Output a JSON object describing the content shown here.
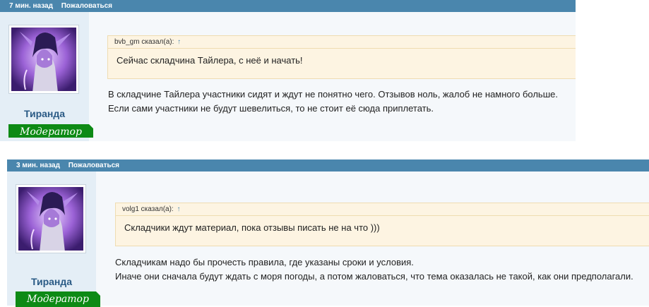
{
  "posts": [
    {
      "time": "7 мин. назад",
      "complain": "Пожаловаться",
      "username": "Тиранда",
      "badge": "Модератор",
      "quote_author": "bvb_gm сказал(а):",
      "quote_arrow": "↑",
      "quote_text": "Сейчас складчина Тайлера, с неё и начать!",
      "message_lines": [
        "В складчине Тайлера участники сидят и ждут не понятно чего. Отзывов ноль, жалоб не намного больше.",
        "Если сами участники не будут шевелиться, то не стоит её сюда приплетать."
      ]
    },
    {
      "time": "3 мин. назад",
      "complain": "Пожаловаться",
      "username": "Тиранда",
      "badge": "Модератор",
      "quote_author": "volg1 сказал(а):",
      "quote_arrow": "↑",
      "quote_text": "Складчики ждут материал, пока отзывы писать не на что )))",
      "message_lines": [
        "Складчикам надо бы прочесть правила, где указаны сроки и условия.",
        "Иначе они сначала будут ждать с моря погоды, а потом жаловаться, что тема оказалась не такой, как они предполагали."
      ]
    }
  ],
  "colors": {
    "header": "#4a86ad",
    "user_column": "#e4eef6",
    "badge": "#0d8a15",
    "quote_bg": "#fdf4e2",
    "username": "#2a5a85"
  }
}
